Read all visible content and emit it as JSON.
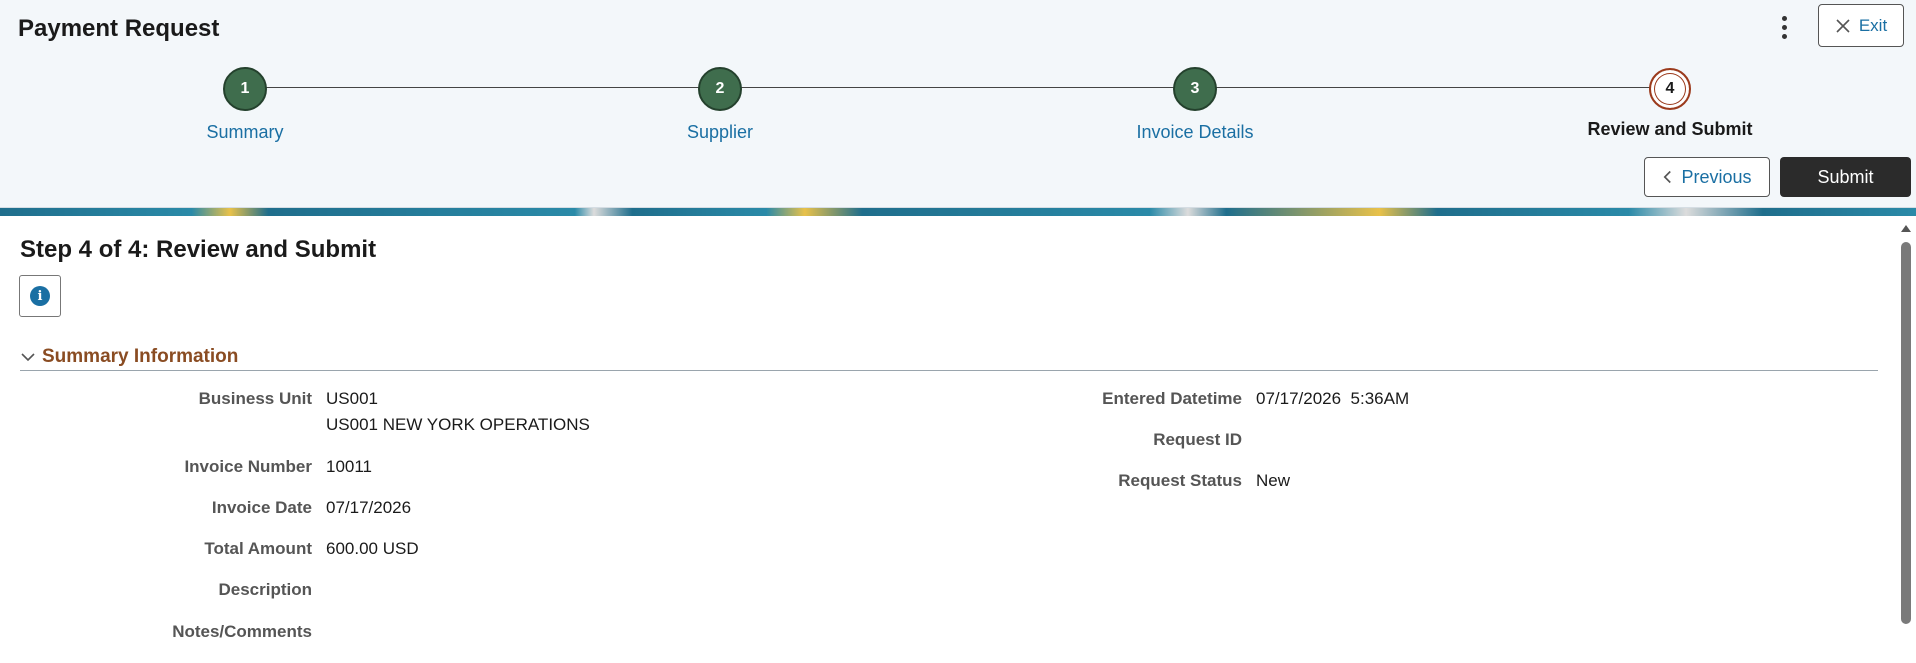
{
  "header": {
    "title": "Payment Request",
    "exit_label": "Exit",
    "previous_label": "Previous",
    "submit_label": "Submit"
  },
  "steps": [
    {
      "number": "1",
      "label": "Summary"
    },
    {
      "number": "2",
      "label": "Supplier"
    },
    {
      "number": "3",
      "label": "Invoice Details"
    },
    {
      "number": "4",
      "label": "Review and Submit"
    }
  ],
  "main": {
    "heading": "Step 4 of 4: Review and Submit",
    "info_icon": "i",
    "section_title": "Summary Information"
  },
  "fields_left": [
    {
      "label": "Business Unit",
      "value": "US001",
      "value2": "US001 NEW YORK OPERATIONS"
    },
    {
      "label": "Invoice Number",
      "value": "10011"
    },
    {
      "label": "Invoice Date",
      "value": "07/17/2026"
    },
    {
      "label": "Total Amount",
      "value": "600.00 USD"
    },
    {
      "label": "Description",
      "value": ""
    },
    {
      "label": "Notes/Comments",
      "value": ""
    }
  ],
  "fields_right": [
    {
      "label": "Entered Datetime",
      "value": "07/17/2026  5:36AM"
    },
    {
      "label": "Request ID",
      "value": ""
    },
    {
      "label": "Request Status",
      "value": "New"
    }
  ],
  "colors": {
    "accent_link": "#1a6fa3",
    "step_complete": "#3f6d4d",
    "step_current_ring": "#9b3a1c",
    "section_title": "#8a4c22"
  }
}
